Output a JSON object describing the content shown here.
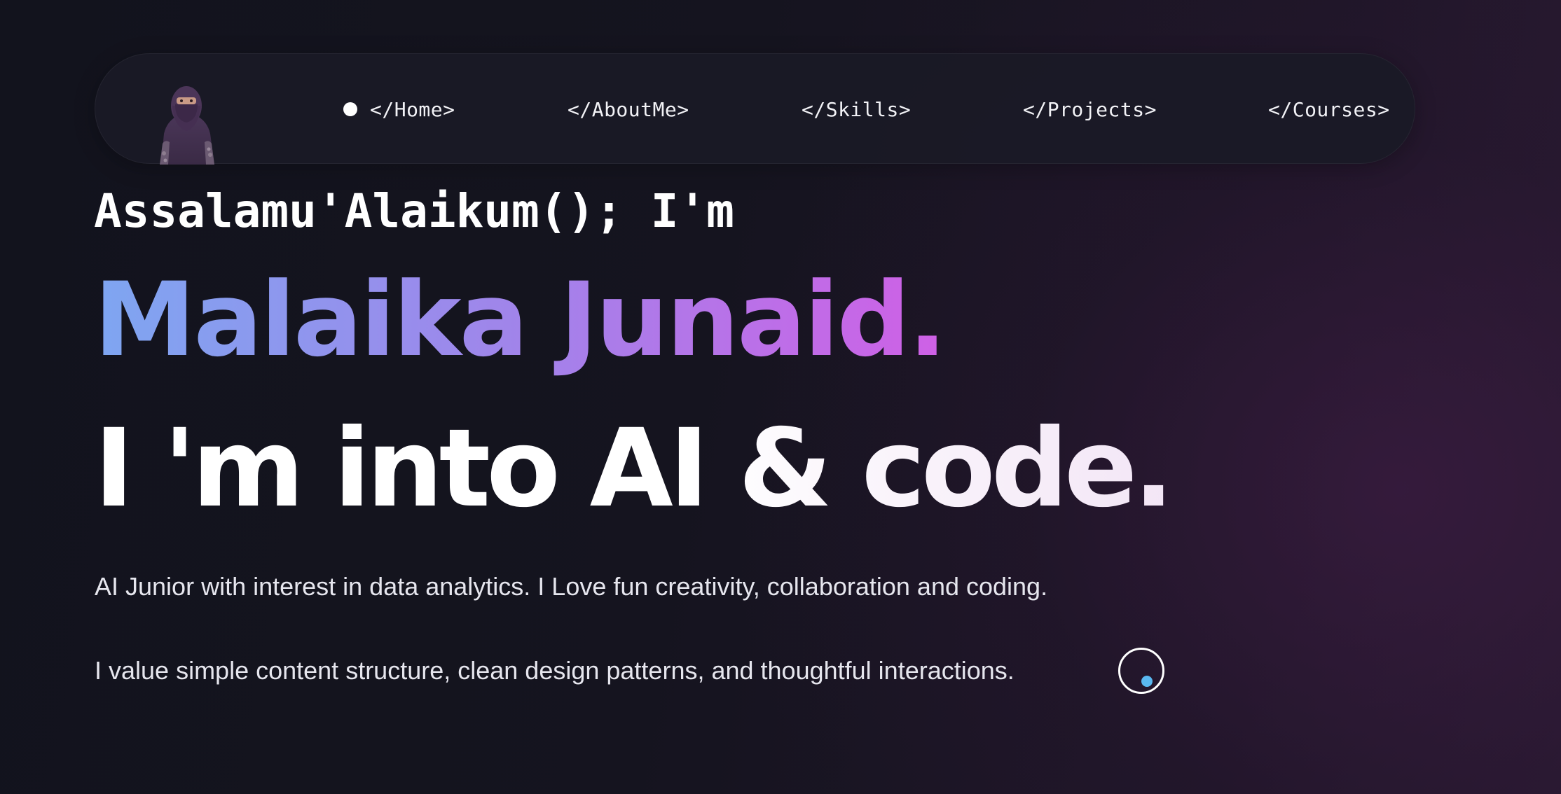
{
  "nav": {
    "avatar_icon": "profile-photo-woman-niqab",
    "active_indicator_color": "#ffffff",
    "links": [
      {
        "label": "</Home>",
        "active": true
      },
      {
        "label": "</AboutMe>",
        "active": false
      },
      {
        "label": "</Skills>",
        "active": false
      },
      {
        "label": "</Projects>",
        "active": false
      },
      {
        "label": "</Courses>",
        "active": false
      }
    ]
  },
  "hero": {
    "greeting": "Assalamu'Alaikum(); I'm",
    "name": "Malaika Junaid.",
    "tagline": "I 'm into AI & code.",
    "bio_1": "AI Junior with interest in data analytics. I Love fun creativity, collaboration and coding.",
    "bio_2": "I value simple content structure, clean design patterns, and thoughtful interactions."
  },
  "colors": {
    "name_gradient_start": "#7ea6f1",
    "name_gradient_end": "#cf60e6",
    "scroll_dot": "#5ab8f0",
    "background": "#12131d"
  }
}
